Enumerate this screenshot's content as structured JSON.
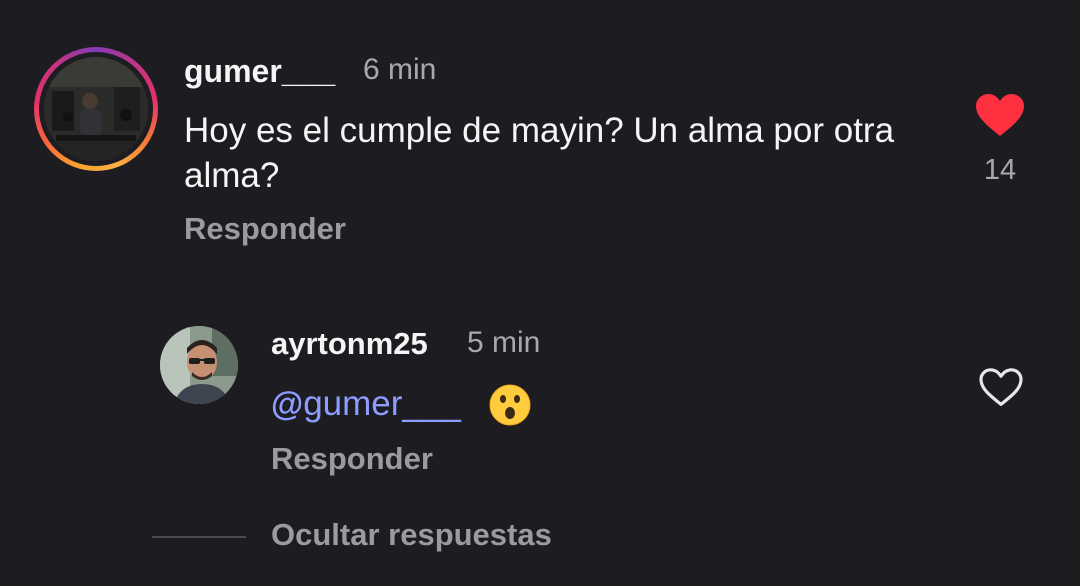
{
  "comments": [
    {
      "username": "gumer___",
      "time": "6 min",
      "text": "Hoy es el cumple de mayin? Un alma por otra alma?",
      "reply_label": "Responder",
      "likes": "14",
      "liked": true
    }
  ],
  "replies": [
    {
      "username": "ayrtonm25",
      "time": "5 min",
      "mention_symbol": "@",
      "mention": "gumer___",
      "emoji": "😮",
      "reply_label": "Responder",
      "liked": false
    }
  ],
  "thread": {
    "hide_replies_label": "Ocultar respuestas"
  },
  "colors": {
    "background": "#1c1c21",
    "like_active": "#ff3040",
    "mention": "#8c9cff",
    "muted": "#9a9a9f"
  }
}
